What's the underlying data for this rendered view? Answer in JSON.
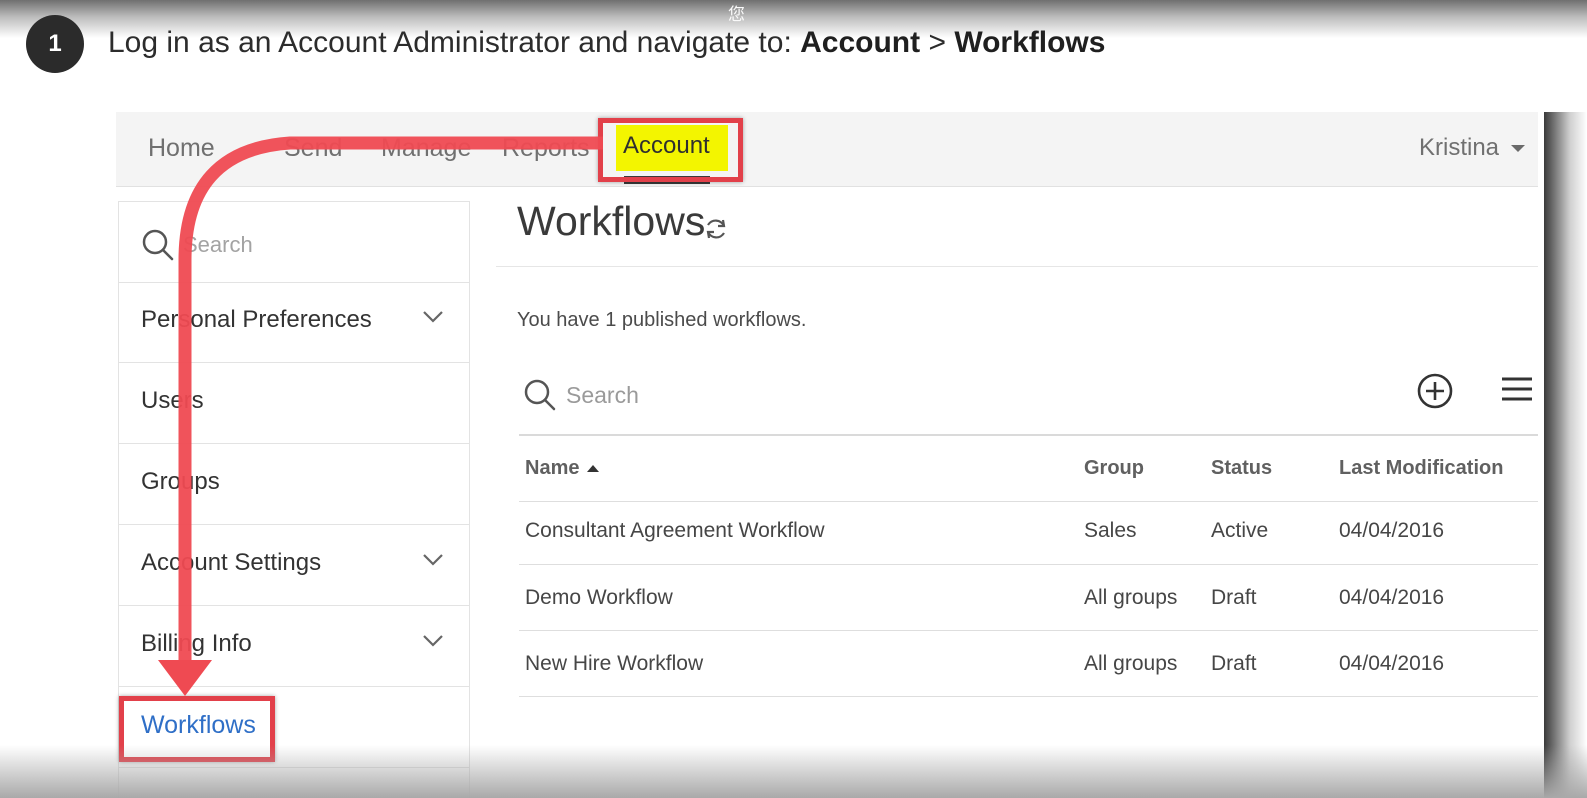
{
  "overlay": {
    "watermark": "您",
    "step_number": "1",
    "instruction_prefix": "Log in as an Account Administrator and navigate to: ",
    "instruction_path_1": "Account",
    "instruction_separator": " > ",
    "instruction_path_2": "Workflows"
  },
  "nav": {
    "items": [
      "Home",
      "Send",
      "Manage",
      "Reports"
    ],
    "active": "Account",
    "user": "Kristina"
  },
  "sidebar": {
    "search_placeholder": "Search",
    "items": [
      {
        "label": "Personal Preferences",
        "expandable": true
      },
      {
        "label": "Users",
        "expandable": false
      },
      {
        "label": "Groups",
        "expandable": false
      },
      {
        "label": "Account Settings",
        "expandable": true
      },
      {
        "label": "Billing Info",
        "expandable": true
      }
    ],
    "selected": "Workflows"
  },
  "main": {
    "title": "Workflows",
    "published_text": "You have 1 published workflows.",
    "search_placeholder": "Search",
    "columns": [
      "Name",
      "Group",
      "Status",
      "Last Modification"
    ],
    "rows": [
      {
        "name": "Consultant Agreement Workflow",
        "group": "Sales",
        "status": "Active",
        "modified": "04/04/2016"
      },
      {
        "name": "Demo Workflow",
        "group": "All groups",
        "status": "Draft",
        "modified": "04/04/2016"
      },
      {
        "name": "New Hire Workflow",
        "group": "All groups",
        "status": "Draft",
        "modified": "04/04/2016"
      }
    ]
  },
  "colors": {
    "callout": "#e2404a",
    "highlight": "#f3f500",
    "link": "#2f6fc7"
  }
}
